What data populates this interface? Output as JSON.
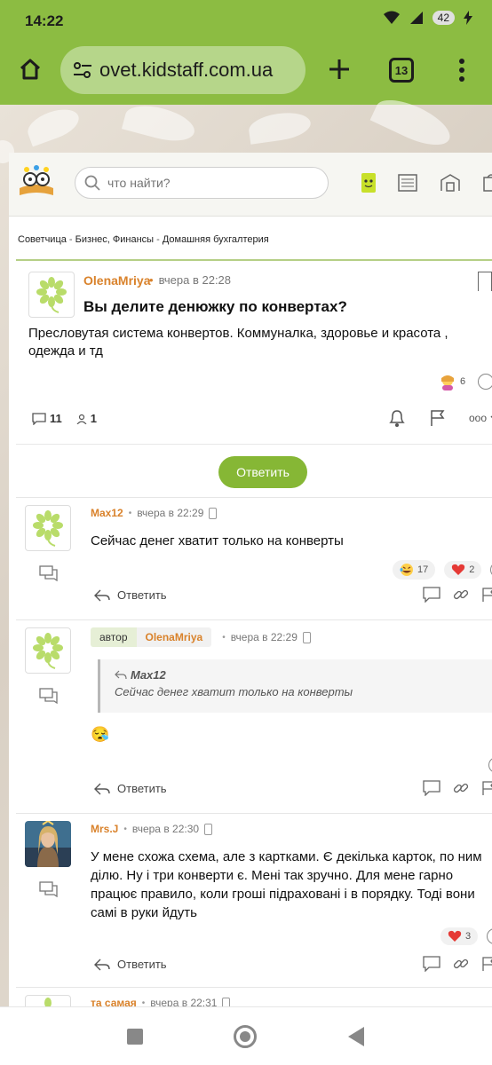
{
  "status_bar": {
    "time": "14:22",
    "battery": "42"
  },
  "browser": {
    "url": "ovet.kidstaff.com.ua",
    "tabs_count": "13"
  },
  "header": {
    "search_placeholder": "что найти?"
  },
  "breadcrumb": {
    "items": [
      "Советчица",
      "Бизнес, Финансы",
      "Домашняя бухгалтерия"
    ],
    "separator": " - "
  },
  "topic": {
    "author": "OlenaMriya",
    "bullet": "•",
    "time": "вчера в 22:28",
    "title": "Вы делите денюжку по конвертах?",
    "text": "Пресловутая система конвертов. Коммуналка, здоровье и красота , одежда и тд",
    "reaction_count": "6",
    "comments_count": "11",
    "participants_count": "1",
    "more_label": "ooo",
    "reply_button": "Ответить"
  },
  "posts": [
    {
      "author": "Max12",
      "time": "вчера в 22:29",
      "num": "1",
      "text": "Сейчас денег хватит только на конверты",
      "reactions": [
        {
          "icon": "laugh-emoji",
          "count": "17"
        },
        {
          "icon": "heart-emoji",
          "count": "2"
        }
      ],
      "reply_label": "Ответить"
    },
    {
      "author_badge": "автор",
      "author": "OlenaMriya",
      "time": "вчера в 22:29",
      "num": "2",
      "quote_author": "Max12",
      "quote_text": "Сейчас денег хватит только на конверты",
      "emoji": "😪",
      "reply_label": "Ответить"
    },
    {
      "author": "Mrs.J",
      "time": "вчера в 22:30",
      "num": "3",
      "text": "У мене схожа схема, але з картками. Є декілька карток, по ним ділю. Ну і три конверти є. Мені так зручно. Для мене гарно працює правило, коли гроші підраховані і в порядку. Тоді вони самі в руки йдуть",
      "reactions": [
        {
          "icon": "heart-emoji",
          "count": "3"
        }
      ],
      "reply_label": "Ответить"
    },
    {
      "author": "та самая",
      "time": "вчера в 22:31"
    }
  ],
  "colors": {
    "chrome": "#8cbc42",
    "accent": "#86b735",
    "author": "#d9822b"
  }
}
